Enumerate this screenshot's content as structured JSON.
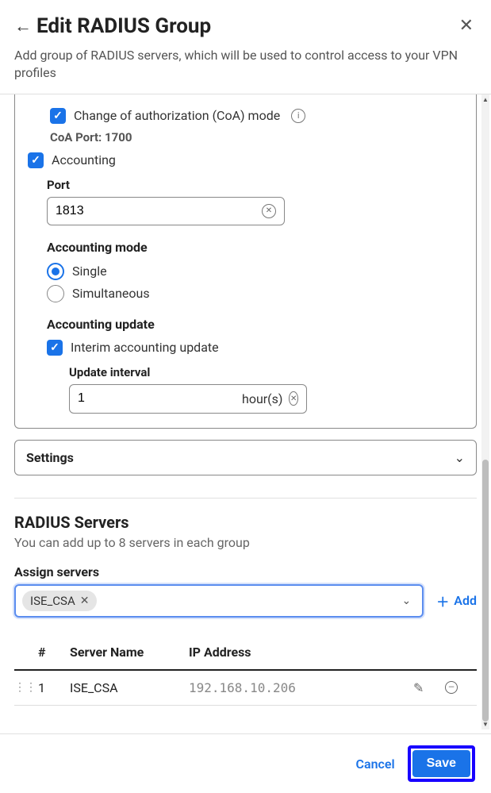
{
  "header": {
    "title": "Edit RADIUS Group",
    "subtitle": "Add group of RADIUS servers, which will be used to control access to your VPN profiles"
  },
  "coa": {
    "label": "Change of authorization (CoA) mode",
    "port_label": "CoA Port: 1700"
  },
  "accounting": {
    "label": "Accounting",
    "port_label": "Port",
    "port_value": "1813",
    "mode_label": "Accounting mode",
    "mode_single": "Single",
    "mode_simultaneous": "Simultaneous",
    "update_label": "Accounting update",
    "interim_label": "Interim accounting update",
    "interval_label": "Update interval",
    "interval_value": "1",
    "interval_unit": "hour(s)"
  },
  "settings_label": "Settings",
  "servers": {
    "heading": "RADIUS Servers",
    "subtext": "You can add up to 8 servers in each group",
    "assign_label": "Assign servers",
    "chip": "ISE_CSA",
    "add_label": "Add",
    "cols": {
      "num": "#",
      "name": "Server Name",
      "ip": "IP Address"
    },
    "row": {
      "num": "1",
      "name": "ISE_CSA",
      "ip": "192.168.10.206"
    }
  },
  "footer": {
    "cancel": "Cancel",
    "save": "Save"
  }
}
